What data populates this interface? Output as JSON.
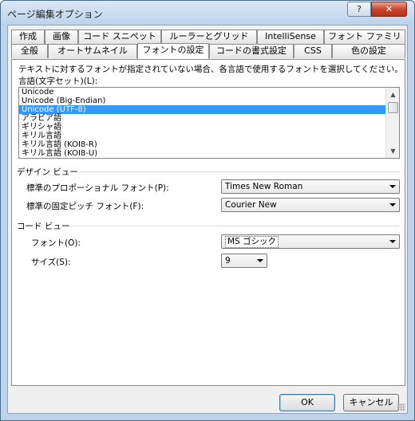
{
  "window": {
    "title": "ページ編集オプション",
    "help_label": "?",
    "close_label": "✕"
  },
  "tabs": {
    "row1": [
      "作成",
      "画像",
      "コード スニペット",
      "ルーラーとグリッド",
      "IntelliSense",
      "フォント ファミリ"
    ],
    "row2": [
      "全般",
      "オートサムネイル",
      "フォントの設定",
      "コードの書式設定",
      "CSS",
      "色の設定"
    ],
    "active": "フォントの設定"
  },
  "font_settings": {
    "description": "テキストに対するフォントが指定されていない場合、各言語で使用するフォントを選択してください。",
    "language_label": "言語(文字セット)(L):",
    "languages": [
      "Unicode",
      "Unicode (Big-Endian)",
      "Unicode (UTF-8)",
      "アラビア語",
      "ギリシャ語",
      "キリル言語",
      "キリル言語 (KOI8-R)",
      "キリル言語 (KOI8-U)"
    ],
    "selected_language": "Unicode (UTF-8)"
  },
  "design_view": {
    "heading": "デザイン ビュー",
    "proportional_label": "標準のプロポーショナル フォント(P):",
    "proportional_value": "Times New Roman",
    "fixed_label": "標準の固定ピッチ フォント(F):",
    "fixed_value": "Courier New"
  },
  "code_view": {
    "heading": "コード ビュー",
    "font_label": "フォント(O):",
    "font_value": "MS ゴシック",
    "size_label": "サイズ(S):",
    "size_value": "9"
  },
  "buttons": {
    "ok": "OK",
    "cancel": "キャンセル"
  },
  "colors": {
    "selection": "#3399ff",
    "close": "#c9462c"
  }
}
